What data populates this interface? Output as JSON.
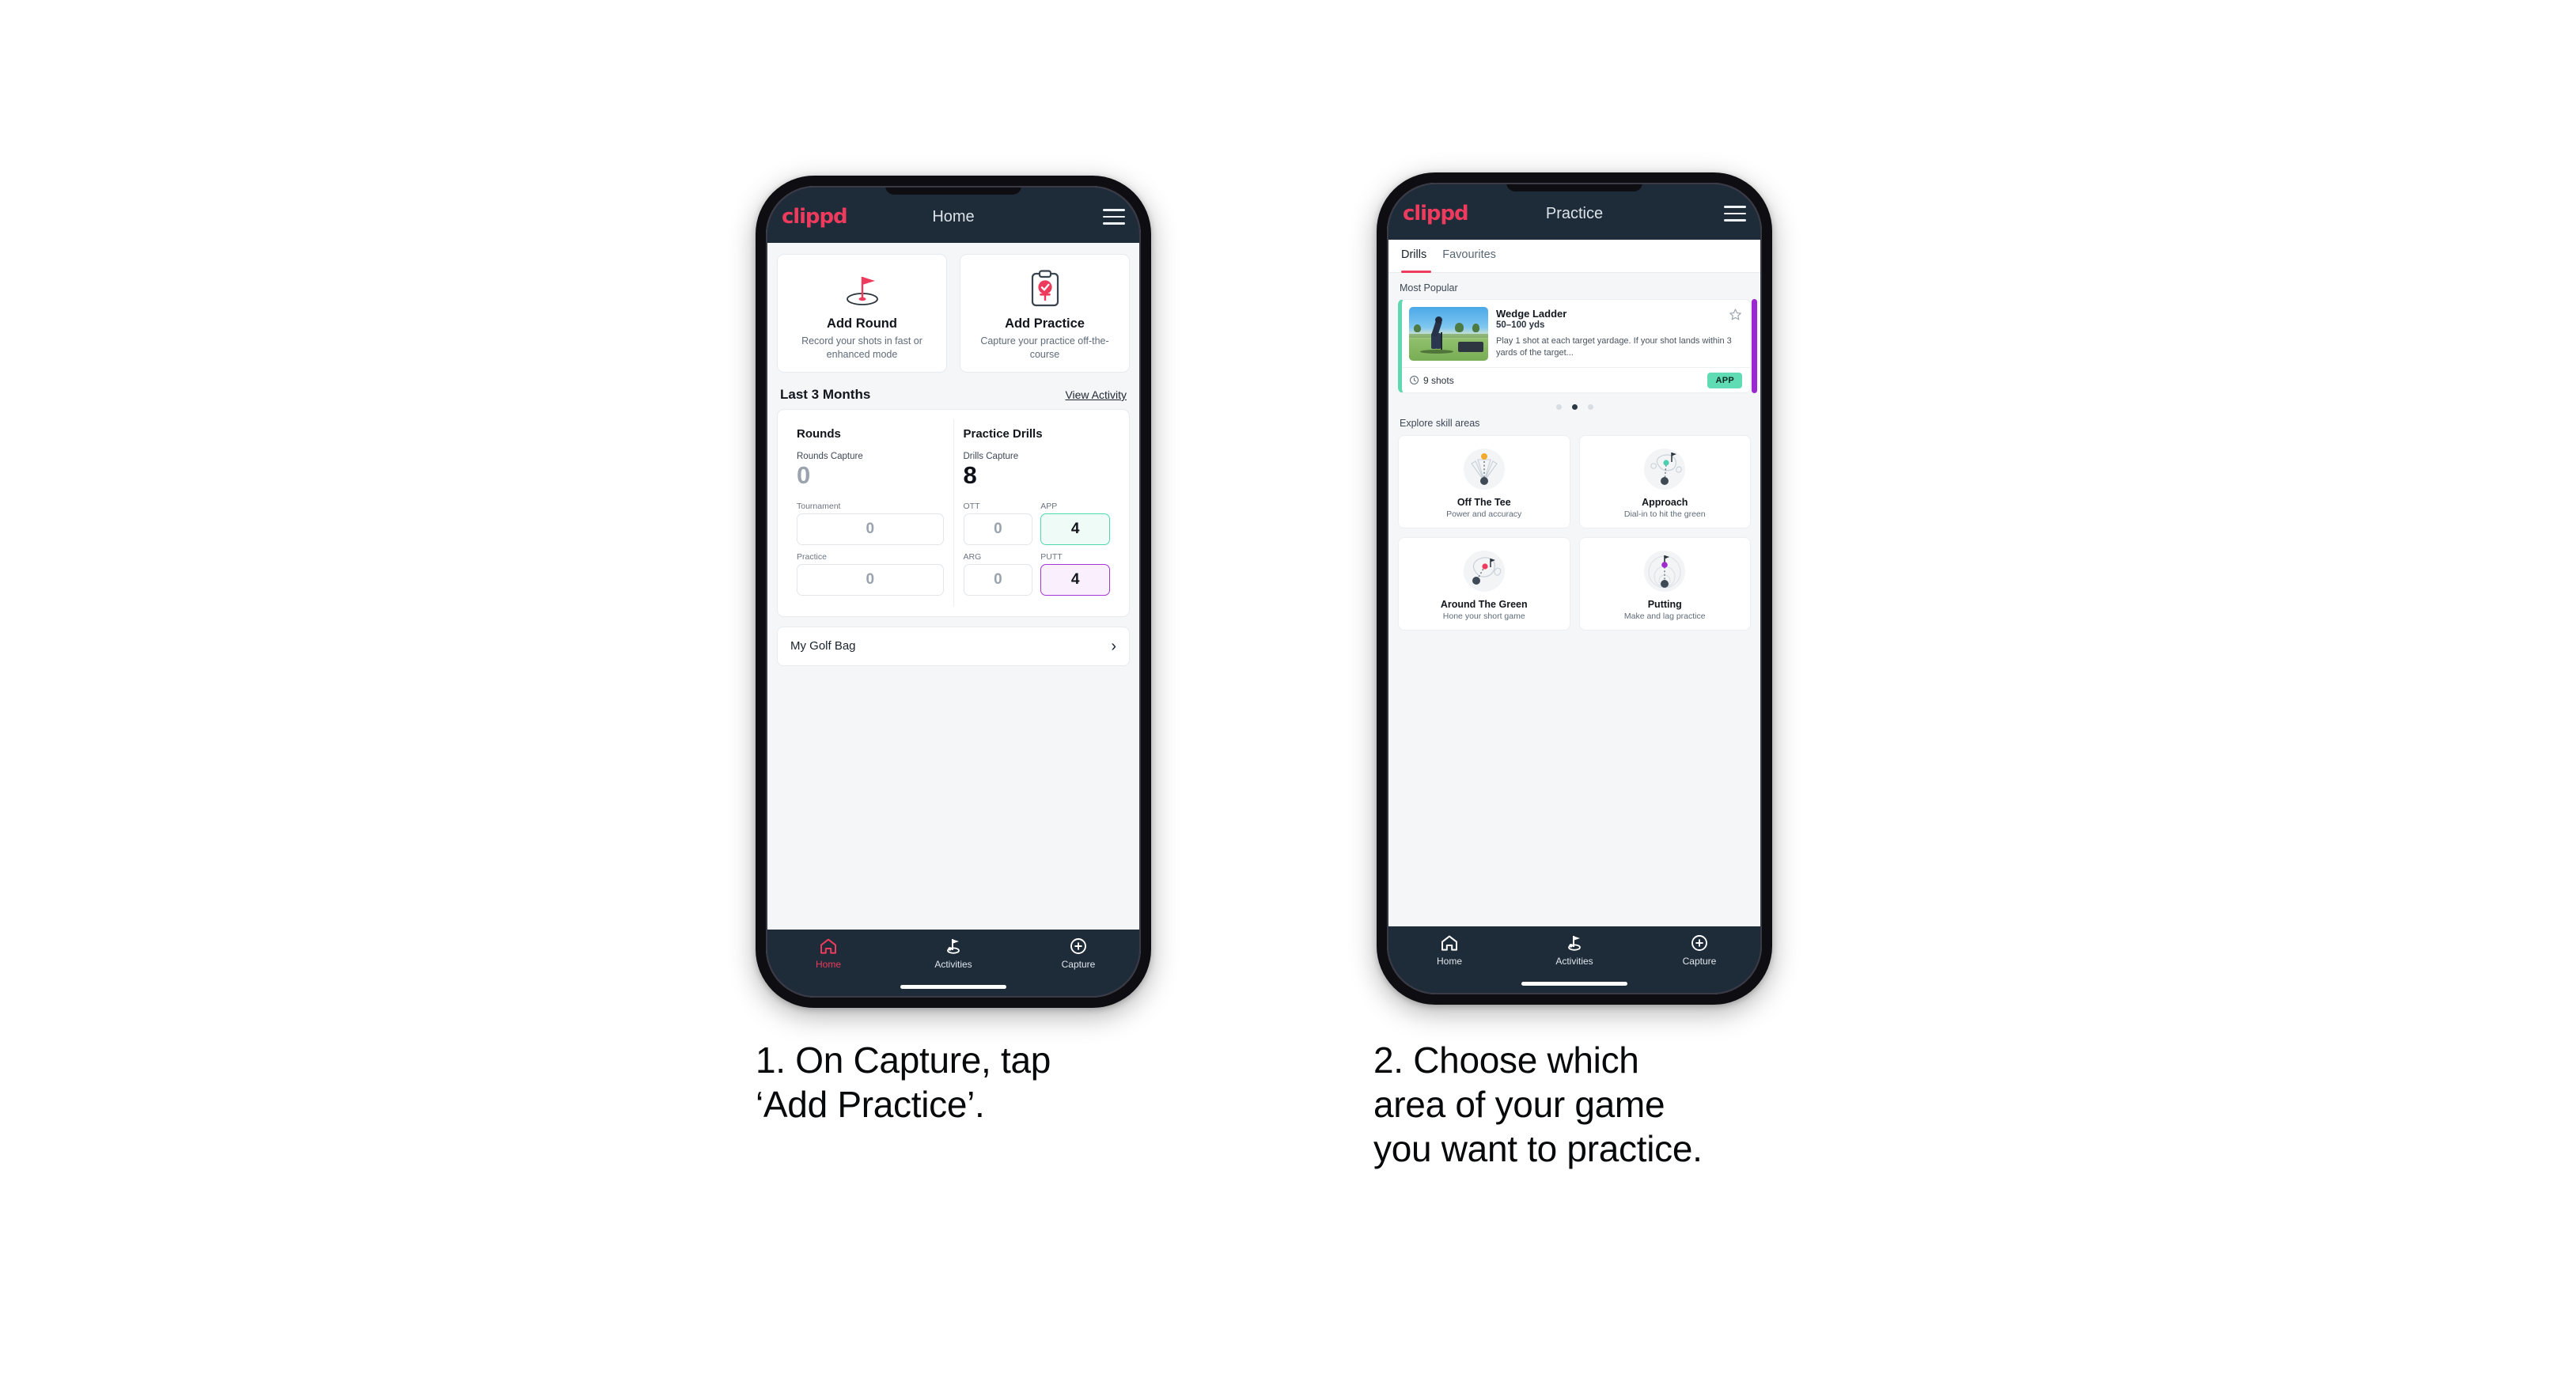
{
  "brand": {
    "logo_text": "clippd",
    "accent": "#ee3a5c",
    "appbar_bg": "#1e2b38"
  },
  "phone1": {
    "appbar": {
      "title": "Home",
      "menu_icon": "hamburger-menu-icon"
    },
    "actions": [
      {
        "icon": "golf-flag-hole-icon",
        "title": "Add Round",
        "sub": "Record your shots in\nfast or enhanced mode"
      },
      {
        "icon": "clipboard-check-tee-icon",
        "title": "Add Practice",
        "sub": "Capture your practice\noff-the-course"
      }
    ],
    "section": {
      "title": "Last 3 Months",
      "link": "View Activity"
    },
    "rounds": {
      "heading": "Rounds",
      "capture_label": "Rounds Capture",
      "capture_value": "0",
      "items": [
        {
          "label": "Tournament",
          "value": "0"
        },
        {
          "label": "Practice",
          "value": "0"
        }
      ]
    },
    "drills": {
      "heading": "Practice Drills",
      "capture_label": "Drills Capture",
      "capture_value": "8",
      "items": [
        {
          "label": "OTT",
          "value": "0",
          "state": "plain"
        },
        {
          "label": "APP",
          "value": "4",
          "state": "green"
        },
        {
          "label": "ARG",
          "value": "0",
          "state": "plain"
        },
        {
          "label": "PUTT",
          "value": "4",
          "state": "purple"
        }
      ]
    },
    "golf_bag": {
      "label": "My Golf Bag",
      "chevron_icon": "chevron-right-icon"
    },
    "nav": [
      {
        "icon": "home-icon",
        "label": "Home",
        "active": true
      },
      {
        "icon": "golf-flag-icon",
        "label": "Activities",
        "active": false
      },
      {
        "icon": "plus-circle-icon",
        "label": "Capture",
        "active": false
      }
    ]
  },
  "phone2": {
    "appbar": {
      "title": "Practice",
      "menu_icon": "hamburger-menu-icon"
    },
    "tabs": [
      {
        "label": "Drills",
        "active": true
      },
      {
        "label": "Favourites",
        "active": false
      }
    ],
    "most_popular_label": "Most Popular",
    "drill": {
      "title": "Wedge Ladder",
      "yardage": "50–100 yds",
      "description": "Play 1 shot at each target yardage. If your shot lands within 3 yards of the target...",
      "shots": "9 shots",
      "shots_icon": "clock-icon",
      "badge": "APP",
      "badge_color": "#5fdcb4",
      "star_icon": "star-outline-icon",
      "accent_color": "#5fd8b0",
      "next_card_color": "#9b27d0"
    },
    "carousel_dots": {
      "count": 3,
      "active_index": 1
    },
    "explore_label": "Explore skill areas",
    "skills": [
      {
        "icon": "off-the-tee-icon",
        "name": "Off The Tee",
        "sub": "Power and accuracy",
        "dot_color": "#f0ab2e"
      },
      {
        "icon": "approach-icon",
        "name": "Approach",
        "sub": "Dial-in to hit the green",
        "dot_color": "#4ccfb0"
      },
      {
        "icon": "around-the-green-icon",
        "name": "Around The Green",
        "sub": "Hone your short game",
        "dot_color": "#ee3a5c"
      },
      {
        "icon": "putting-icon",
        "name": "Putting",
        "sub": "Make and lag practice",
        "dot_color": "#a02bd0"
      }
    ],
    "nav": [
      {
        "icon": "home-icon",
        "label": "Home",
        "active": false
      },
      {
        "icon": "golf-flag-icon",
        "label": "Activities",
        "active": false
      },
      {
        "icon": "plus-circle-icon",
        "label": "Capture",
        "active": false
      }
    ]
  },
  "captions": {
    "step1": "1. On Capture, tap\n‘Add Practice’.",
    "step2": "2. Choose which\narea of your game\nyou want to practice."
  }
}
